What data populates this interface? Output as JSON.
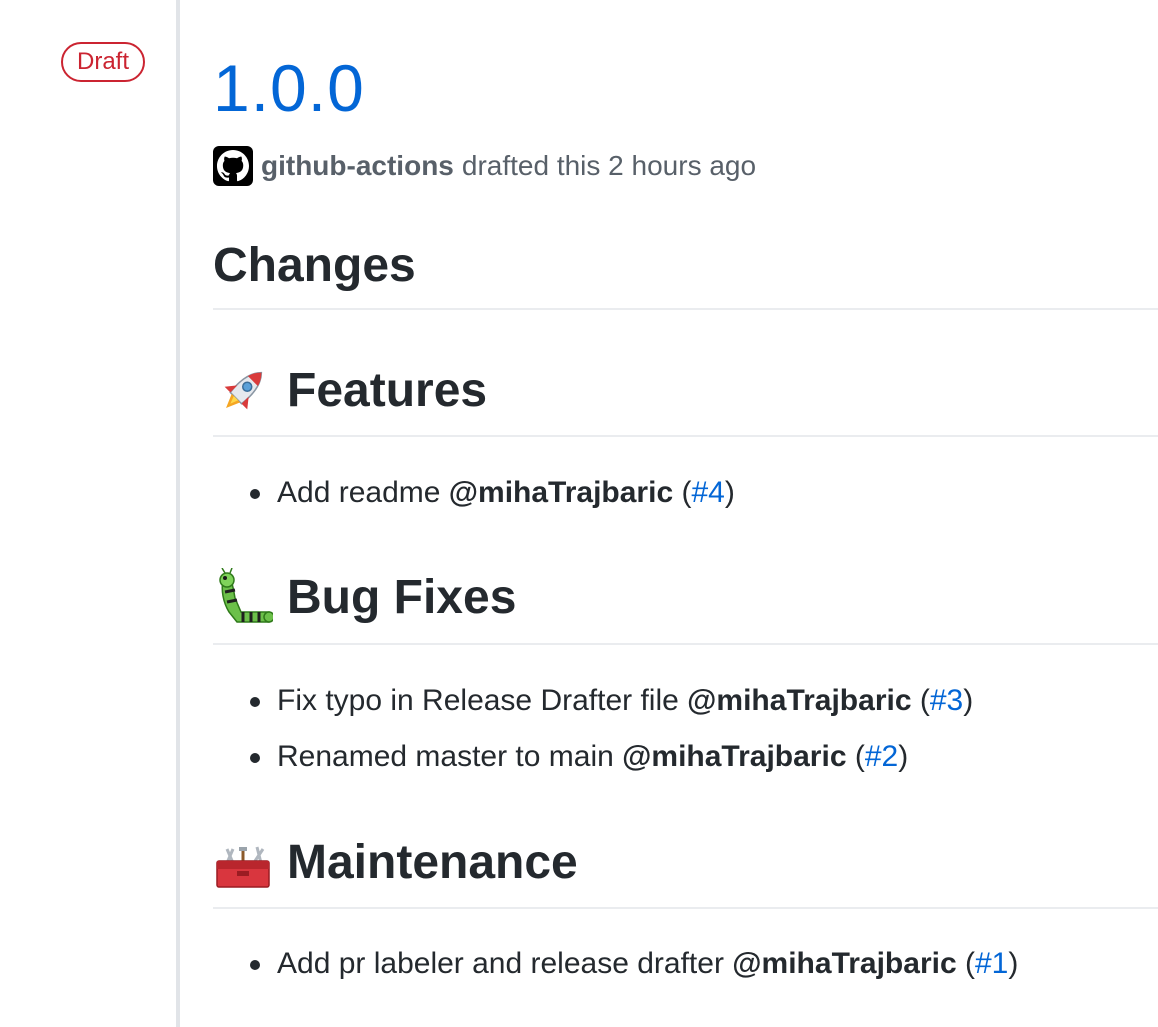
{
  "badge": "Draft",
  "release": {
    "title": "1.0.0",
    "author": "github-actions",
    "drafted_text": "drafted this 2 hours ago"
  },
  "changes_heading": "Changes",
  "sections": {
    "features": {
      "title": "Features",
      "icon": "rocket-icon",
      "items": [
        {
          "text": "Add readme",
          "mention": "@mihaTrajbaric",
          "pr": "#4"
        }
      ]
    },
    "bug_fixes": {
      "title": "Bug Fixes",
      "icon": "bug-icon",
      "items": [
        {
          "text": "Fix typo in Release Drafter file",
          "mention": "@mihaTrajbaric",
          "pr": "#3"
        },
        {
          "text": "Renamed master to main",
          "mention": "@mihaTrajbaric",
          "pr": "#2"
        }
      ]
    },
    "maintenance": {
      "title": "Maintenance",
      "icon": "toolbox-icon",
      "items": [
        {
          "text": "Add pr labeler and release drafter",
          "mention": "@mihaTrajbaric",
          "pr": "#1"
        }
      ]
    }
  },
  "colors": {
    "link": "#0366d6",
    "draft": "#cb2431",
    "text": "#24292e",
    "muted": "#586069"
  }
}
